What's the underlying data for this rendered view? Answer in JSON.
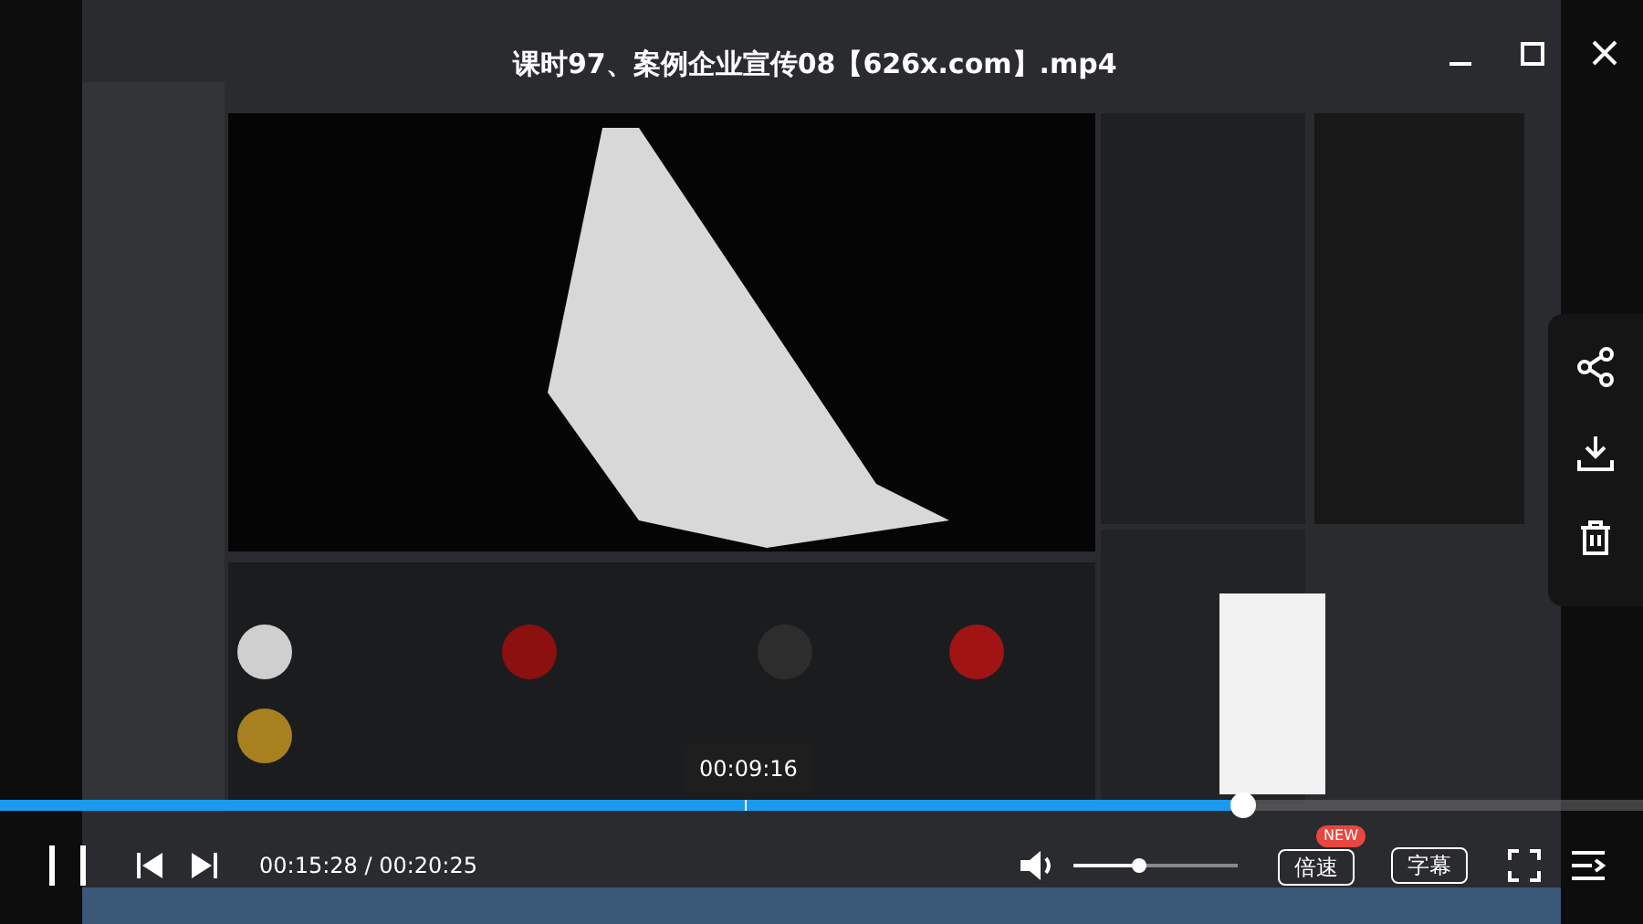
{
  "window": {
    "title": "课时97、案例企业宣传08【626x.com】.mp4"
  },
  "player": {
    "playing": true,
    "progress": {
      "level": 0.757
    },
    "hover_time": "00:09:16",
    "time": "00:15:28 / 00:20:25",
    "volume": {
      "level": 0.4
    },
    "speed_button": {
      "label": "倍速",
      "badge": "NEW"
    },
    "subtitle_button": {
      "label": "字幕"
    }
  }
}
